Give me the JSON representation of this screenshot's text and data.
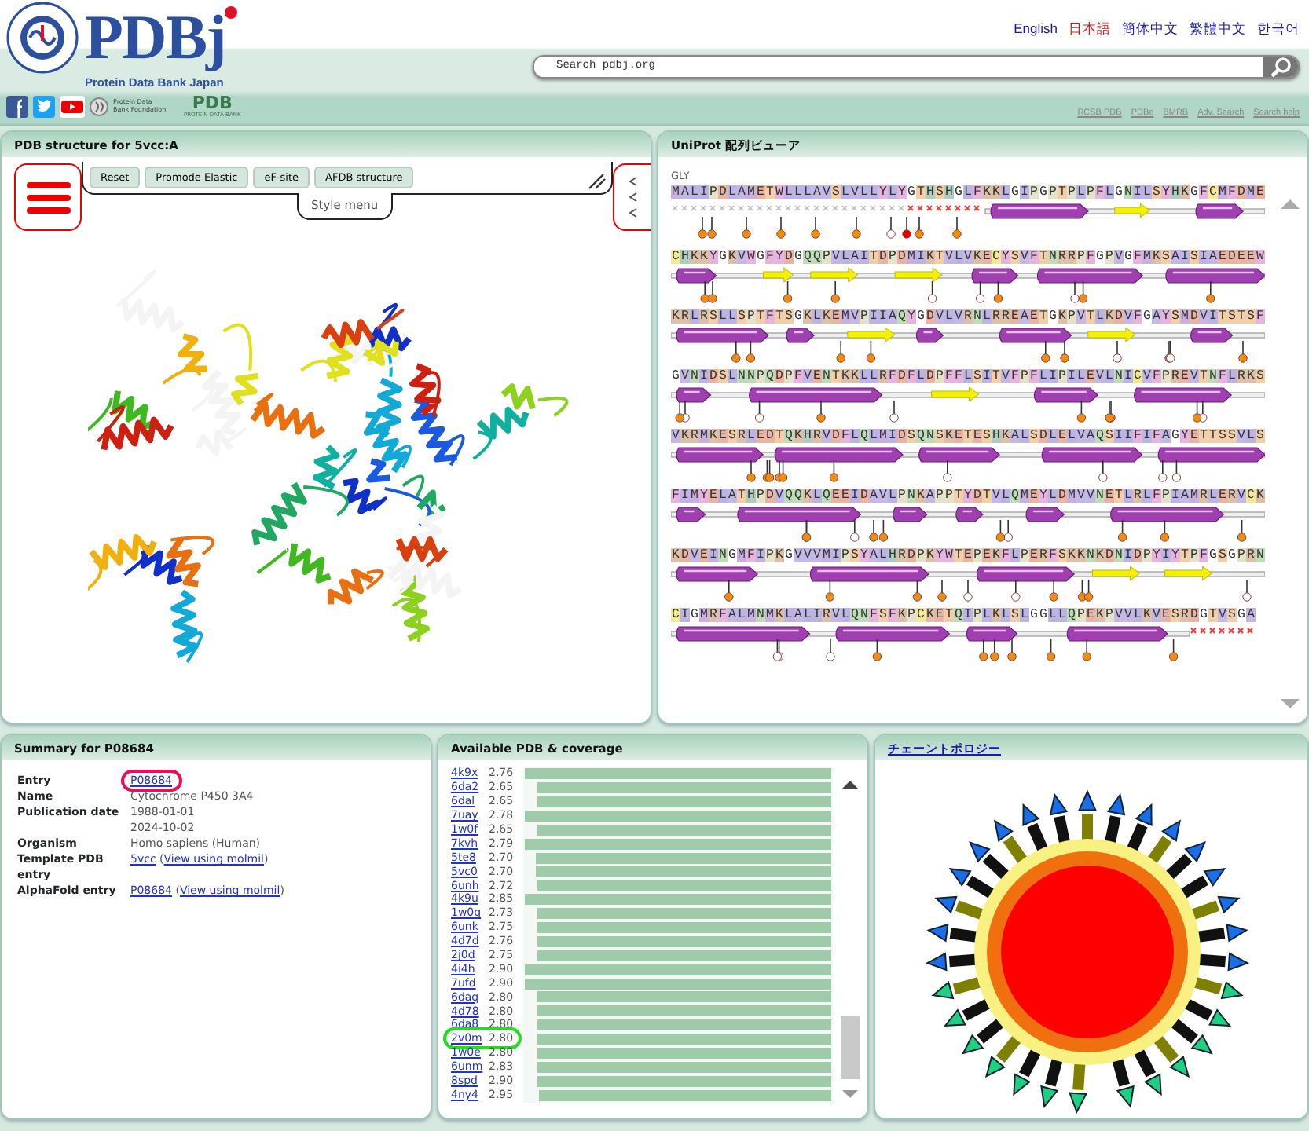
{
  "header": {
    "logo": {
      "title": "PDBj",
      "subtitle": "Protein Data Bank Japan"
    },
    "languages": [
      {
        "label": "English",
        "selected": false
      },
      {
        "label": "日本語",
        "selected": true
      },
      {
        "label": "簡体中文",
        "selected": false
      },
      {
        "label": "繁體中文",
        "selected": false
      },
      {
        "label": "한국어",
        "selected": false
      }
    ],
    "search": {
      "placeholder": "Search pdbj.org"
    },
    "foundation": "Protein Data Bank Foundation",
    "pdb_logo": {
      "title": "PDB",
      "caption": "PROTEIN DATA BANK"
    },
    "links": [
      "RCSB PDB",
      "PDBe",
      "BMRB",
      "Adv. Search",
      "Search help"
    ]
  },
  "structure_panel": {
    "title": "PDB structure for 5vcc:A",
    "buttons": [
      "Reset",
      "Promode Elastic",
      "eF-site",
      "AFDB structure"
    ],
    "style_menu": "Style menu"
  },
  "sequence_panel": {
    "title": "UniProt 配列ビューア",
    "residue_label": "GLY",
    "rows": [
      "MALIPDLAMETWLLLAVSLVLLYLYGTHSHGLFKKLGIPGPTPLPFLGNILSYHKGFCMFDME",
      "CHKKYGKVWGFYDGQQPVLAITDPDMIKTVLVKECYSVFTNRRPFGPVGFMKSAISIAEDEEW",
      "KRLRSLLSPTFTSGKLKEMVPIIAQYGDVLVRNLRREAETGKPVTLKDVFGAYSMDVITSTSF",
      "GVNIDSLNNPQDPFVENTKKLLRFDFLDPFFLSITVFPFLIPILEVLNICVFPREVTNFLRKS",
      "VKRMKESRLEDTQKHRVDFLQLMIDSQNSKETESHKALSDLELVAQSIIFIFAGYETTSSVLS",
      "FIMYELATHPDVQQKLQEEIDAVLPNKAPPTYDTVLQMEYLDMVVNETLRLFPIAMRLERVCK",
      "KDVEINGMFIPKGVVVMIPSYALHRDPKYWTEPEKFLPERFSKKNKDNIDPYIYTPFGSGPRN",
      "CIGMRFALMNMKLALIRVLQNFSFKPCKETQIPLKLSLGGLLQPEKPVVLKVESRDGTVSGA"
    ]
  },
  "summary_panel": {
    "title": "Summary for P08684",
    "fields": [
      {
        "label": "Entry",
        "lines": [
          [
            {
              "text": "P08684",
              "kind": "link",
              "circled": true
            }
          ]
        ]
      },
      {
        "label": "Name",
        "lines": [
          [
            {
              "text": "Cytochrome P450 3A4",
              "kind": "text",
              "circled": false
            }
          ]
        ]
      },
      {
        "label": "Publication date",
        "lines": [
          [
            {
              "text": "1988-01-01",
              "kind": "text",
              "circled": false
            }
          ],
          [
            {
              "text": "2024-10-02",
              "kind": "text",
              "circled": false
            }
          ]
        ]
      },
      {
        "label": "Organism",
        "lines": [
          [
            {
              "text": "Homo sapiens (Human)",
              "kind": "text",
              "circled": false
            }
          ]
        ]
      },
      {
        "label": "Template PDB entry",
        "lines": [
          [
            {
              "text": "5vcc",
              "kind": "link",
              "circled": false
            },
            {
              "text": "(",
              "kind": "text",
              "circled": false
            },
            {
              "text": "View using molmil",
              "kind": "link",
              "circled": false
            },
            {
              "text": ")",
              "kind": "text",
              "circled": false
            }
          ]
        ]
      },
      {
        "label": "AlphaFold entry",
        "lines": [
          [
            {
              "text": "P08684",
              "kind": "link",
              "circled": false
            },
            {
              "text": "(",
              "kind": "text",
              "circled": false
            },
            {
              "text": "View using molmil",
              "kind": "link",
              "circled": false
            },
            {
              "text": ")",
              "kind": "text",
              "circled": false
            }
          ]
        ]
      }
    ]
  },
  "coverage_panel": {
    "title": "Available PDB & coverage",
    "rows": [
      {
        "code": "4k9x",
        "resolution": "2.76",
        "level": 1.0,
        "circled": false
      },
      {
        "code": "6da2",
        "resolution": "2.65",
        "level": 0.96,
        "circled": false
      },
      {
        "code": "6dal",
        "resolution": "2.65",
        "level": 0.96,
        "circled": false
      },
      {
        "code": "7uay",
        "resolution": "2.78",
        "level": 1.0,
        "circled": false
      },
      {
        "code": "1w0f",
        "resolution": "2.65",
        "level": 0.96,
        "circled": false
      },
      {
        "code": "7kvh",
        "resolution": "2.79",
        "level": 1.0,
        "circled": false
      },
      {
        "code": "5te8",
        "resolution": "2.70",
        "level": 0.965,
        "circled": false
      },
      {
        "code": "5vc0",
        "resolution": "2.70",
        "level": 0.965,
        "circled": false
      },
      {
        "code": "6unh",
        "resolution": "2.72",
        "level": 0.96,
        "circled": false
      },
      {
        "code": "4k9u",
        "resolution": "2.85",
        "level": 1.0,
        "circled": false
      },
      {
        "code": "1w0g",
        "resolution": "2.73",
        "level": 0.96,
        "circled": false
      },
      {
        "code": "6unk",
        "resolution": "2.75",
        "level": 0.96,
        "circled": false
      },
      {
        "code": "4d7d",
        "resolution": "2.76",
        "level": 0.96,
        "circled": false
      },
      {
        "code": "2j0d",
        "resolution": "2.75",
        "level": 0.96,
        "circled": false
      },
      {
        "code": "4i4h",
        "resolution": "2.90",
        "level": 1.0,
        "circled": false
      },
      {
        "code": "7ufd",
        "resolution": "2.90",
        "level": 1.0,
        "circled": false
      },
      {
        "code": "6daq",
        "resolution": "2.80",
        "level": 0.96,
        "circled": false
      },
      {
        "code": "4d78",
        "resolution": "2.80",
        "level": 0.96,
        "circled": false
      },
      {
        "code": "6da8",
        "resolution": "2.80",
        "level": 0.96,
        "circled": false
      },
      {
        "code": "2v0m",
        "resolution": "2.80",
        "level": 0.96,
        "circled": true
      },
      {
        "code": "1w0e",
        "resolution": "2.80",
        "level": 0.96,
        "circled": false
      },
      {
        "code": "6unm",
        "resolution": "2.83",
        "level": 0.96,
        "circled": false
      },
      {
        "code": "8spd",
        "resolution": "2.90",
        "level": 0.96,
        "circled": false
      },
      {
        "code": "4ny4",
        "resolution": "2.95",
        "level": 0.955,
        "circled": false
      }
    ]
  },
  "topology_panel": {
    "title": "チェーントポロジー"
  }
}
